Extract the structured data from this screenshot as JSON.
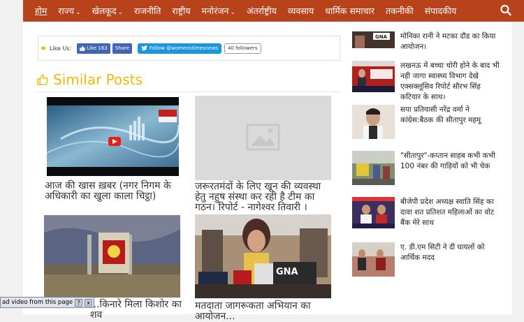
{
  "nav": {
    "items": [
      {
        "label": "होम",
        "chevron": false
      },
      {
        "label": "राज्य",
        "chevron": true
      },
      {
        "label": "खेलकूद",
        "chevron": true
      },
      {
        "label": "राजनीति",
        "chevron": false
      },
      {
        "label": "राष्ट्रीय",
        "chevron": false
      },
      {
        "label": "मनोरंजन",
        "chevron": true
      },
      {
        "label": "अंतर्राष्ट्रीय",
        "chevron": false
      },
      {
        "label": "व्यवसाय",
        "chevron": false
      },
      {
        "label": "धार्मिक समाचार",
        "chevron": false
      },
      {
        "label": "तकनीकी",
        "chevron": false
      },
      {
        "label": "संपादकीय",
        "chevron": false
      }
    ],
    "search_icon": "search-icon",
    "bg_color": "#b8421a"
  },
  "social": {
    "like_label": "Like Us:",
    "fb_like": "Like 163",
    "fb_share": "Share",
    "tw_follow": "Follow @womenstimesnews",
    "tw_count": "40 followers"
  },
  "similar": {
    "title": "Similar Posts",
    "title_color": "#f0b90c",
    "posts": [
      {
        "caption": "आज की खास ख़बर (नगर निगम के अधिकारी का खुला काला चिट्ठा)"
      },
      {
        "caption": "जरूरतमंदों के लिए खून की व्यवस्था हेतु नहुष संस्था कर रही है टीम का गठन। रिपोर्ट - नागेश्वर तिवारी ।"
      },
      {
        "caption": "...किनारे मिला किशोर का शव"
      },
      {
        "caption": "मतदाता जागरूकता अभियान का आयोजन..."
      }
    ]
  },
  "sidebar": {
    "items": [
      {
        "text": "मोनिका रानी ने मटका दौड का किया आयोजन।"
      },
      {
        "text": "लखनऊ में बच्चा चोरी होने के बाद भी नही जागा स्वास्थ्य विभाग देखे एक्सक्लूसिव रिपोर्ट सौरभ सिंह कटियार के साथ।"
      },
      {
        "text": "सपा प्रतियासी नरेंद्र वर्मा ने कांग्रेस:बैठक की सीतापुर महमू"
      },
      {
        "text": "\"सीतापुर\"-कप्तान साहब कभी कभी 100 नंबर की गाड़ियों को भी चेक"
      },
      {
        "text": "बीजेपी प्रदेश अध्यक्ष स्वाति सिंह का दावा शत प्रतिशत महिलाओं का वोट बैंक मेरे साथ"
      },
      {
        "text": "ए. डी.एम सिटी ने दी घायलों को आर्थिक मदद"
      }
    ]
  },
  "tooltip": {
    "text": "ad video from this page",
    "help": "?",
    "close": "x"
  }
}
